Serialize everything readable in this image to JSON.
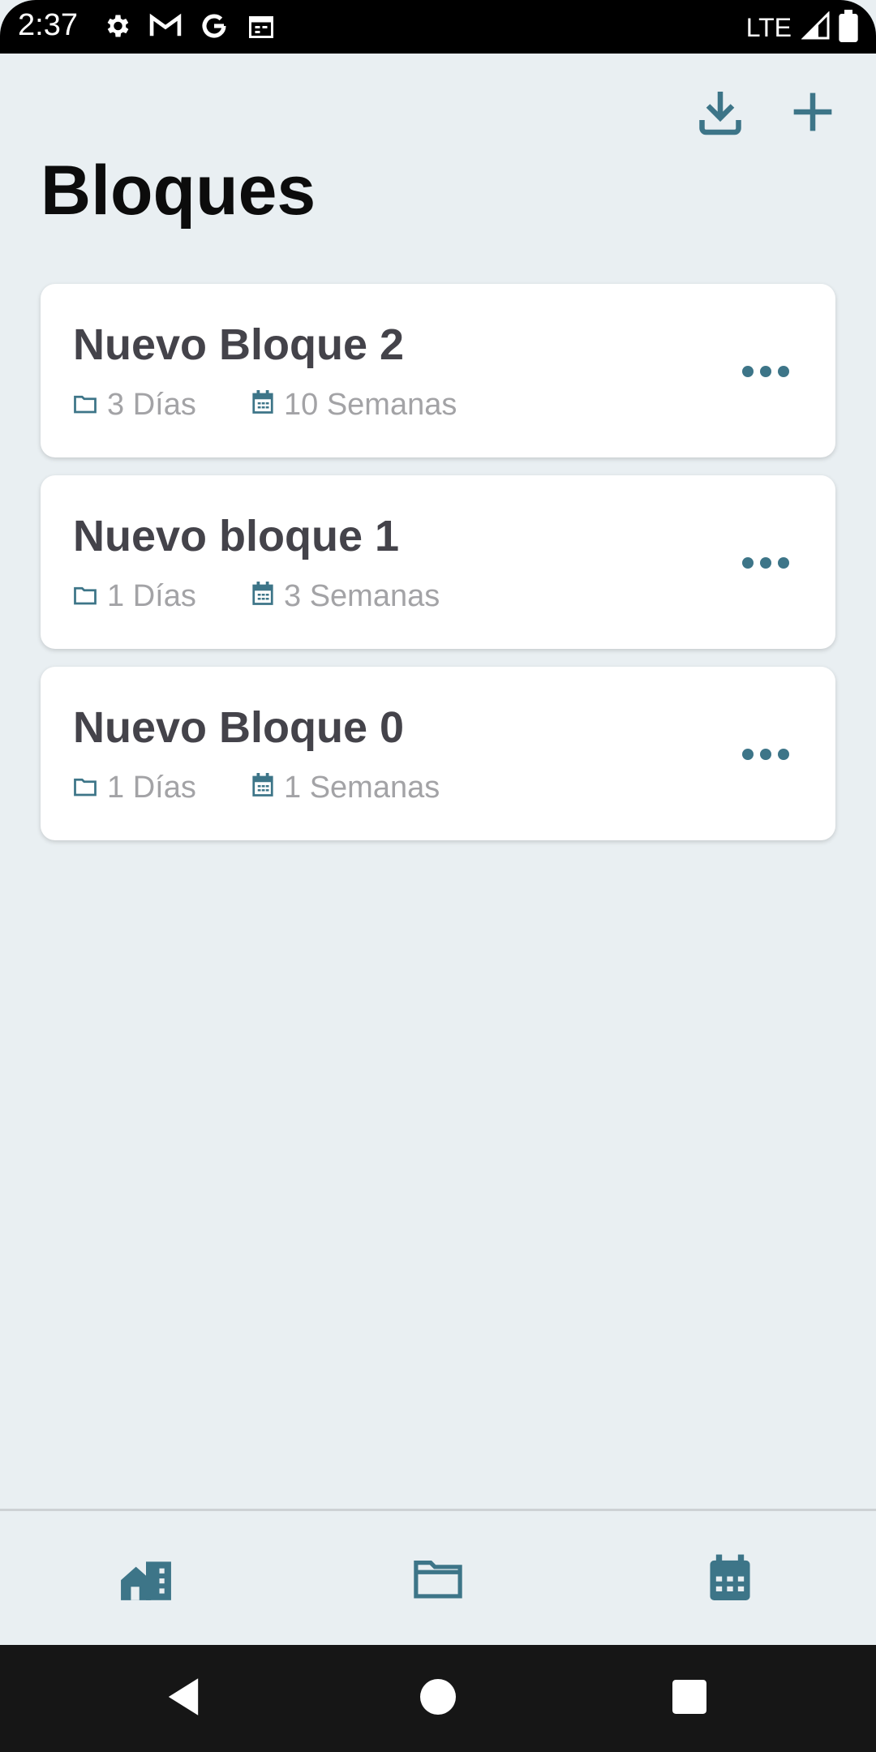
{
  "status_bar": {
    "time": "2:37",
    "network": "LTE",
    "left_icons": [
      "gear-icon",
      "gmail-icon",
      "google-icon",
      "calendar-icon"
    ],
    "right_icons": [
      "signal-icon",
      "battery-icon"
    ]
  },
  "header": {
    "title": "Bloques",
    "actions": [
      "download-icon",
      "add-icon"
    ]
  },
  "blocks": [
    {
      "title": "Nuevo Bloque 2",
      "days": "3 Días",
      "weeks": "10 Semanas"
    },
    {
      "title": "Nuevo bloque 1",
      "days": "1 Días",
      "weeks": "3 Semanas"
    },
    {
      "title": "Nuevo Bloque 0",
      "days": "1 Días",
      "weeks": "1 Semanas"
    }
  ],
  "bottom_nav": {
    "items": [
      "home-buildings-icon",
      "folder-icon",
      "calendar-icon"
    ]
  },
  "system_nav": {
    "items": [
      "back-icon",
      "home-icon",
      "recents-icon"
    ]
  },
  "colors": {
    "accent": "#3d7588",
    "background": "#e9eff2",
    "card": "#ffffff",
    "title_text": "#44434a",
    "meta_text": "#a3a3a6"
  }
}
